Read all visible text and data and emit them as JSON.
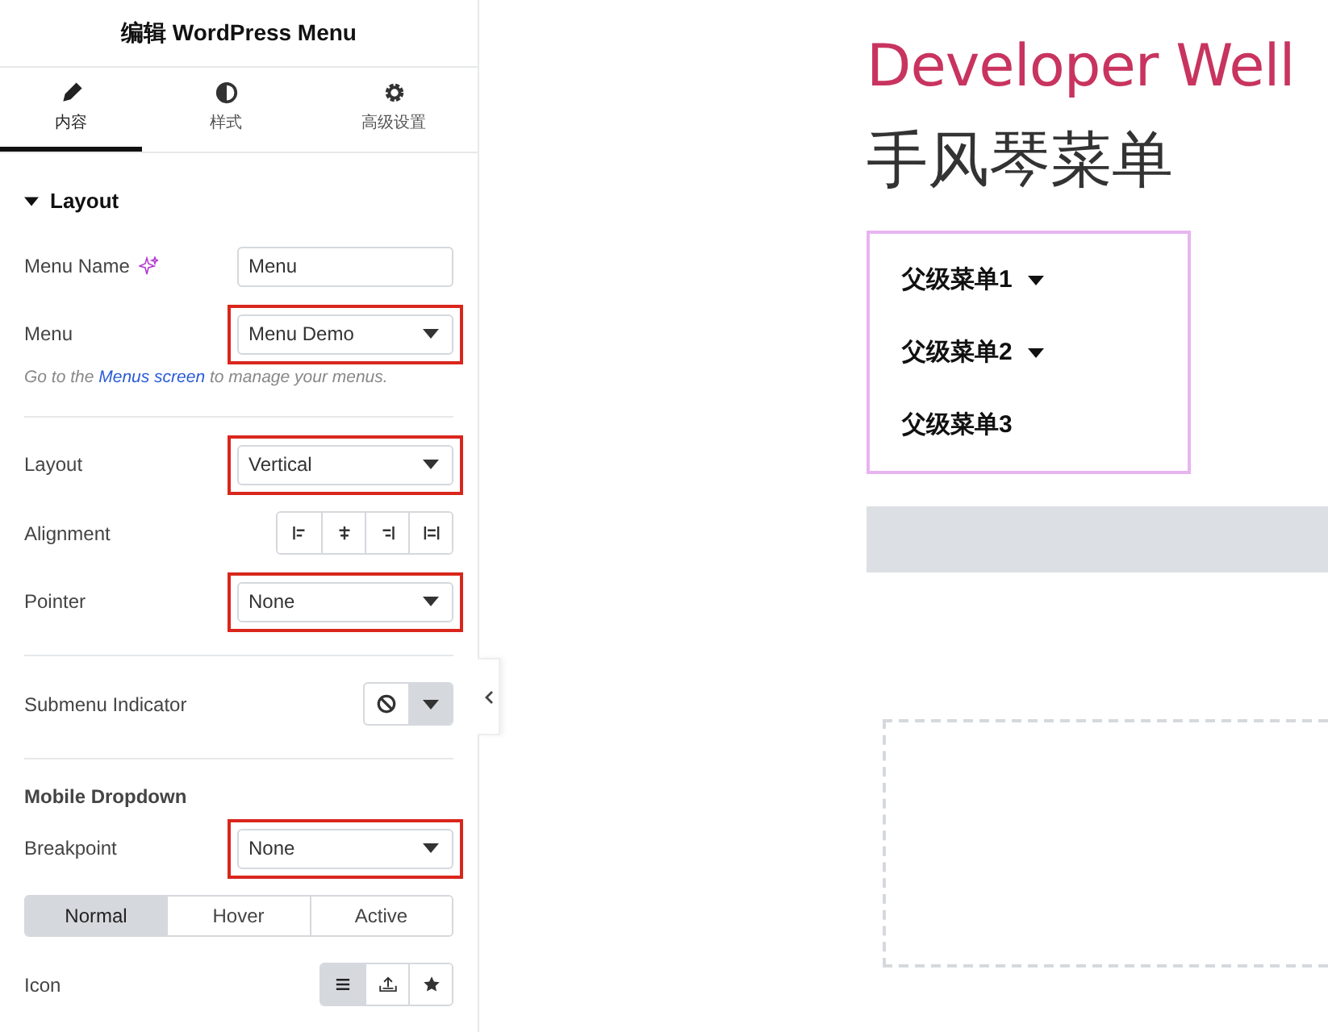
{
  "panel": {
    "title": "编辑 WordPress Menu",
    "tabs": [
      {
        "label": "内容",
        "selected": true
      },
      {
        "label": "样式",
        "selected": false
      },
      {
        "label": "高级设置",
        "selected": false
      }
    ],
    "section": {
      "title": "Layout",
      "expanded": true
    },
    "controls": [
      {
        "kind": "text",
        "label": "Menu Name",
        "ai": true,
        "value": "Menu"
      },
      {
        "kind": "select",
        "label": "Menu",
        "value": "Menu Demo",
        "highlighted": true
      },
      {
        "kind": "hint",
        "before": "Go to the ",
        "link": "Menus screen",
        "after": " to manage your menus."
      },
      {
        "kind": "divider"
      },
      {
        "kind": "select",
        "label": "Layout",
        "value": "Vertical",
        "highlighted": true
      },
      {
        "kind": "align",
        "label": "Alignment",
        "options": [
          {
            "selected": false
          },
          {
            "selected": false
          },
          {
            "selected": false
          },
          {
            "selected": false
          }
        ]
      },
      {
        "kind": "select",
        "label": "Pointer",
        "value": "None",
        "highlighted": true
      },
      {
        "kind": "divider"
      },
      {
        "kind": "indicator",
        "label": "Submenu Indicator"
      },
      {
        "kind": "divider"
      },
      {
        "kind": "heading",
        "label": "Mobile Dropdown"
      },
      {
        "kind": "select",
        "label": "Breakpoint",
        "value": "None",
        "highlighted": true
      },
      {
        "kind": "states",
        "options": [
          {
            "label": "Normal",
            "selected": true
          },
          {
            "label": "Hover",
            "selected": false
          },
          {
            "label": "Active",
            "selected": false
          }
        ]
      },
      {
        "kind": "icons",
        "label": "Icon",
        "options": [
          {
            "selected": true
          },
          {
            "selected": false
          },
          {
            "selected": false
          }
        ]
      }
    ]
  },
  "preview": {
    "site_title": "Developer Well",
    "heading": "手风琴菜单",
    "menu": [
      {
        "label": "父级菜单1",
        "has_children": true
      },
      {
        "label": "父级菜单2",
        "has_children": true
      },
      {
        "label": "父级菜单3",
        "has_children": false
      }
    ]
  }
}
